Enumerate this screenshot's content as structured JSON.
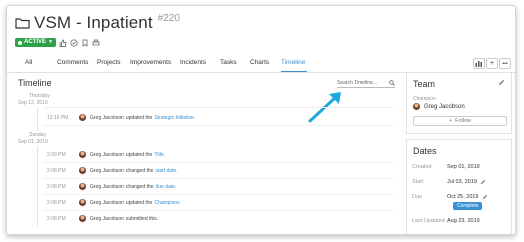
{
  "header": {
    "title": "VSM - Inpatient",
    "ticket": "#220",
    "status": "ACTIVE"
  },
  "tabs": [
    {
      "label": "All"
    },
    {
      "label": "Comments"
    },
    {
      "label": "Projects"
    },
    {
      "label": "Improvements"
    },
    {
      "label": "Incidents"
    },
    {
      "label": "Tasks"
    },
    {
      "label": "Charts"
    },
    {
      "label": "Timeline"
    }
  ],
  "active_tab": "Timeline",
  "toolbar": {
    "chart_icon": "bar-chart-icon",
    "add": "+",
    "more": "•••"
  },
  "timeline": {
    "heading": "Timeline",
    "search_placeholder": "Search Timeline...",
    "days": [
      {
        "weekday": "Thursday",
        "date": "Sep 12, 2019",
        "entries": [
          {
            "time": "12:16 PM",
            "user": "Greg Jacobson",
            "action": "updated the",
            "target": "Strategic Initiative."
          }
        ]
      },
      {
        "weekday": "Sunday",
        "date": "Sep 01, 2019",
        "entries": [
          {
            "time": "2:09 PM",
            "user": "Greg Jacobson",
            "action": "updated the",
            "target": "Title."
          },
          {
            "time": "2:08 PM",
            "user": "Greg Jacobson",
            "action": "changed the",
            "target": "start date."
          },
          {
            "time": "2:08 PM",
            "user": "Greg Jacobson",
            "action": "changed the",
            "target": "due date."
          },
          {
            "time": "2:08 PM",
            "user": "Greg Jacobson",
            "action": "updated the",
            "target": "Champions."
          },
          {
            "time": "2:08 PM",
            "user": "Greg Jacobson",
            "action": "submitted this.",
            "target": ""
          }
        ]
      }
    ]
  },
  "team": {
    "title": "Team",
    "champion_label": "Champion",
    "champion_name": "Greg Jacobson",
    "follow_label": "Follow"
  },
  "dates": {
    "title": "Dates",
    "rows": [
      {
        "label": "Created",
        "value": "Sep 01, 2019"
      },
      {
        "label": "Start",
        "value": "Jul 03, 2019"
      },
      {
        "label": "Due",
        "value": "Oct 25, 2019"
      },
      {
        "label": "Last Updated",
        "value": "Aug 23, 2019"
      }
    ],
    "complete_label": "Complete"
  },
  "colors": {
    "accent": "#3a8fd0",
    "status": "#2ea24b",
    "arrow": "#1ea8e0"
  }
}
